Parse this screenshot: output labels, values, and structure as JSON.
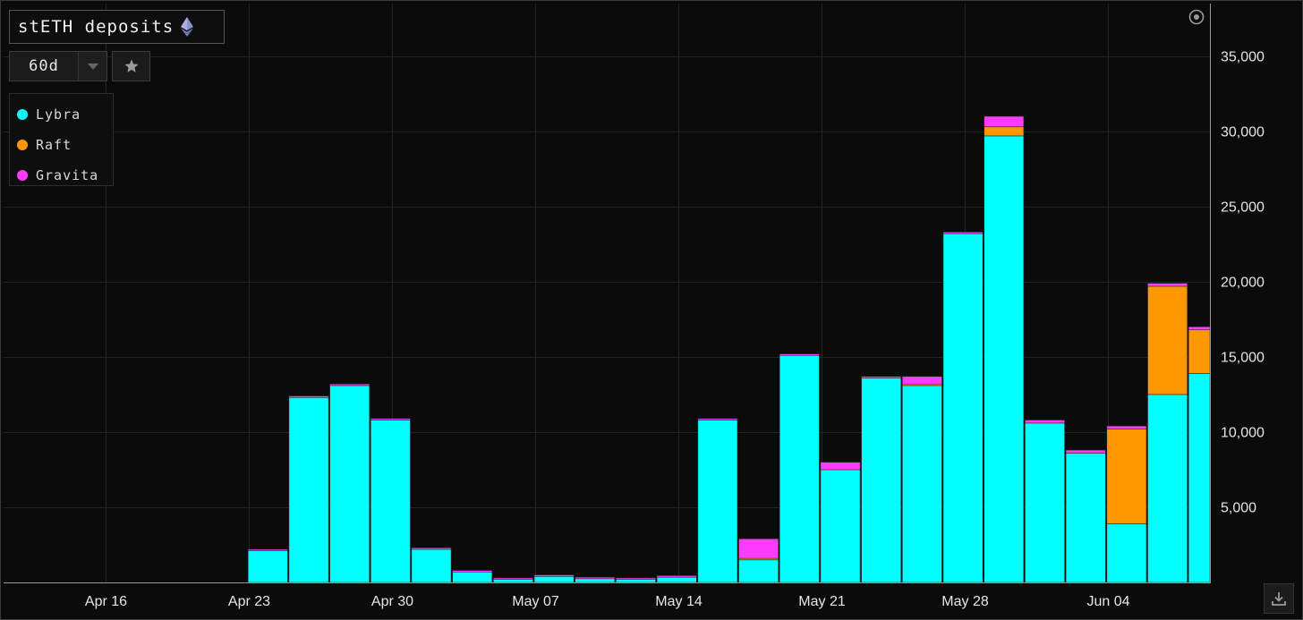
{
  "header": {
    "title": "stETH deposits",
    "title_icon": "ethereum-icon"
  },
  "controls": {
    "range_value": "60d",
    "dropdown_icon": "caret-down-icon",
    "star_icon": "star-icon"
  },
  "toolbar": {
    "target_icon": "target-icon",
    "download_icon": "download-icon"
  },
  "legend": [
    {
      "label": "Lybra",
      "color": "#00ffff"
    },
    {
      "label": "Raft",
      "color": "#ff9800"
    },
    {
      "label": "Gravita",
      "color": "#ff3bff"
    }
  ],
  "chart_data": {
    "type": "bar",
    "stacked": true,
    "title": "stETH deposits",
    "xlabel": "",
    "ylabel": "",
    "x_start": "2023-04-11",
    "x_end": "2023-06-09",
    "x_ticks": [
      {
        "date": "2023-04-16",
        "label": "Apr 16"
      },
      {
        "date": "2023-04-23",
        "label": "Apr 23"
      },
      {
        "date": "2023-04-30",
        "label": "Apr 30"
      },
      {
        "date": "2023-05-07",
        "label": "May 07"
      },
      {
        "date": "2023-05-14",
        "label": "May 14"
      },
      {
        "date": "2023-05-21",
        "label": "May 21"
      },
      {
        "date": "2023-05-28",
        "label": "May 28"
      },
      {
        "date": "2023-06-04",
        "label": "Jun 04"
      }
    ],
    "ylim": [
      0,
      38500
    ],
    "y_ticks": [
      5000,
      10000,
      15000,
      20000,
      25000,
      30000,
      35000
    ],
    "y_tick_labels": [
      "5,000",
      "10,000",
      "15,000",
      "20,000",
      "25,000",
      "30,000",
      "35,000"
    ],
    "grid": true,
    "legend_position": "top-left",
    "categories": [
      "2023-04-23",
      "2023-04-25",
      "2023-04-27",
      "2023-04-29",
      "2023-05-01",
      "2023-05-03",
      "2023-05-05",
      "2023-05-07",
      "2023-05-09",
      "2023-05-11",
      "2023-05-13",
      "2023-05-15",
      "2023-05-17",
      "2023-05-19",
      "2023-05-21",
      "2023-05-23",
      "2023-05-25",
      "2023-05-27",
      "2023-05-29",
      "2023-05-31",
      "2023-06-02",
      "2023-06-04",
      "2023-06-06",
      "2023-06-08"
    ],
    "series": [
      {
        "name": "Lybra",
        "color": "#00ffff",
        "values": [
          2100,
          12300,
          13100,
          10800,
          2200,
          700,
          200,
          400,
          250,
          200,
          350,
          10800,
          1500,
          15100,
          7500,
          13600,
          13100,
          23200,
          29700,
          10600,
          8600,
          3900,
          12500,
          13900
        ]
      },
      {
        "name": "Raft",
        "color": "#ff9800",
        "values": [
          0,
          0,
          0,
          0,
          0,
          0,
          0,
          0,
          0,
          0,
          0,
          0,
          100,
          0,
          0,
          0,
          100,
          0,
          600,
          0,
          0,
          6300,
          7200,
          2900
        ]
      },
      {
        "name": "Gravita",
        "color": "#ff3bff",
        "values": [
          100,
          100,
          100,
          100,
          100,
          100,
          100,
          100,
          100,
          100,
          100,
          100,
          1300,
          100,
          500,
          100,
          500,
          100,
          700,
          200,
          200,
          200,
          200,
          200
        ]
      }
    ]
  }
}
